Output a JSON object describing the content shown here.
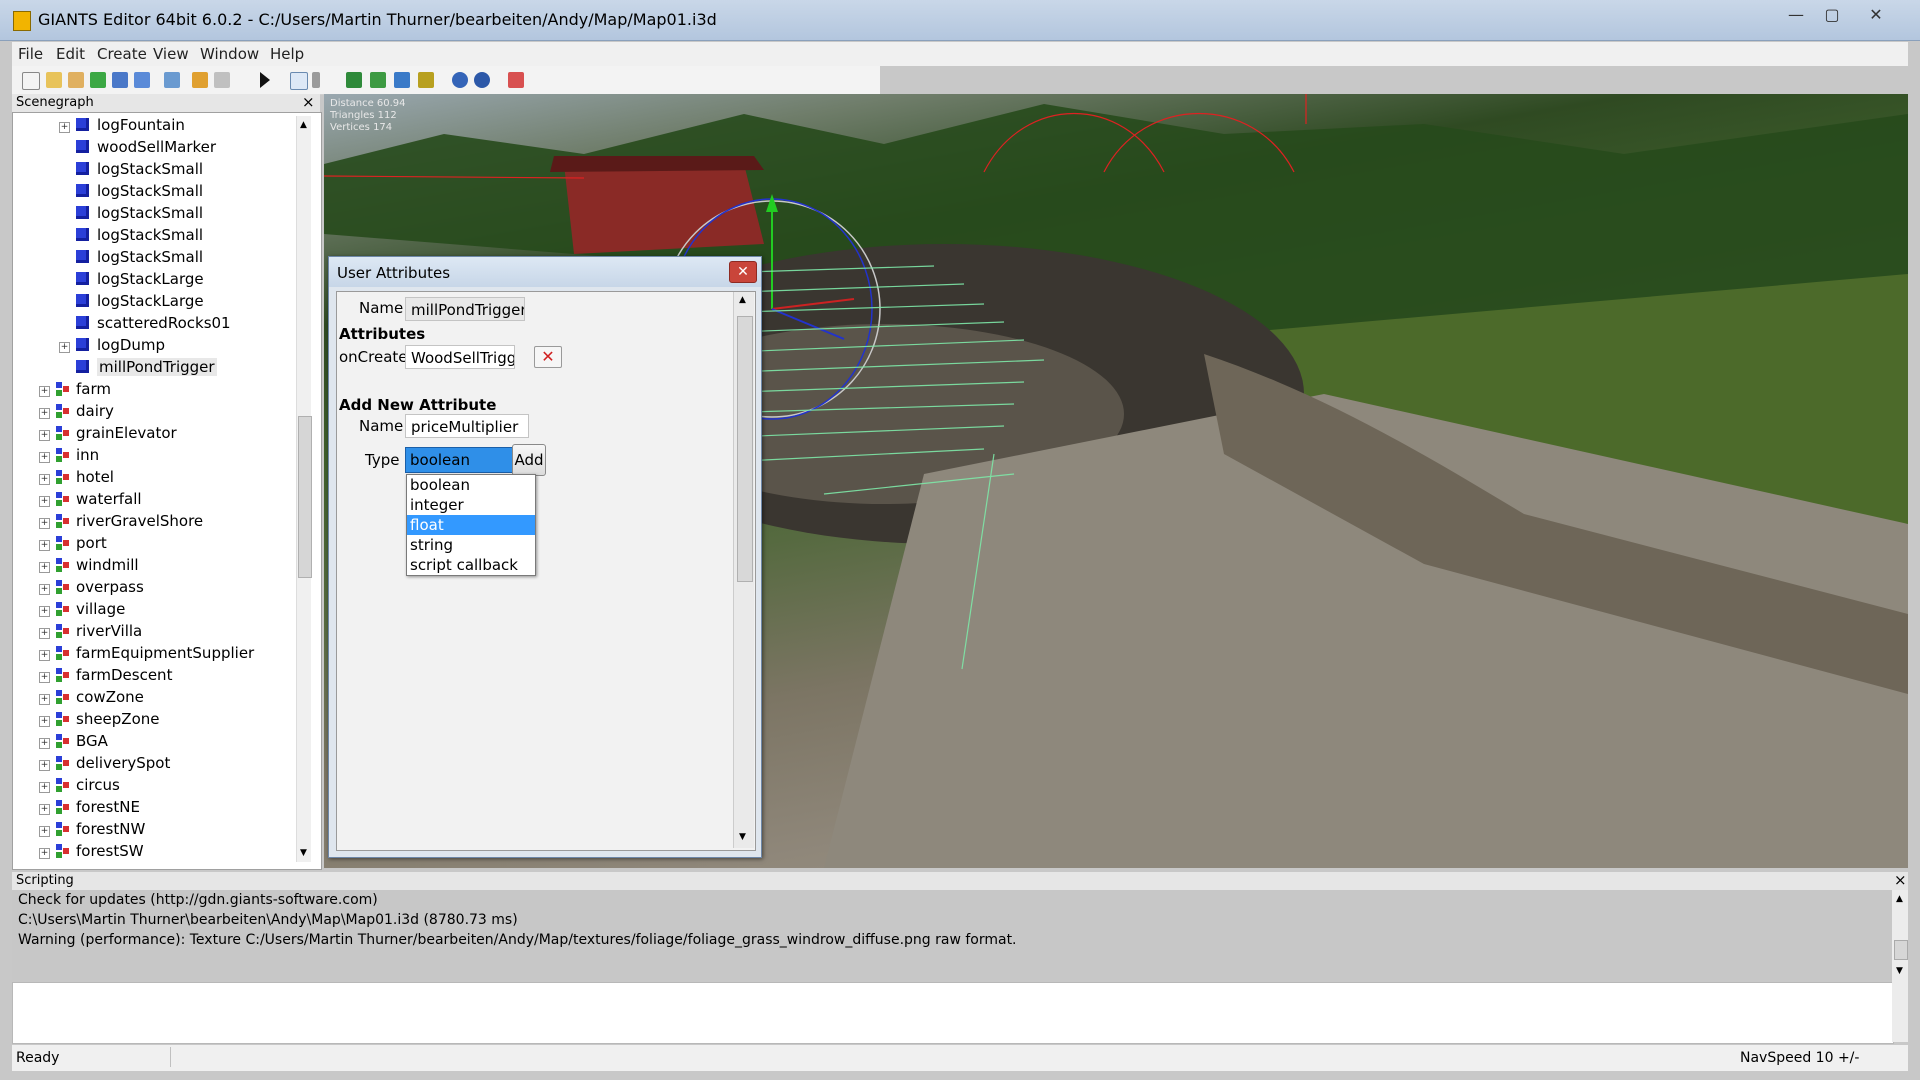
{
  "window": {
    "title": "GIANTS Editor 64bit 6.0.2 - C:/Users/Martin Thurner/bearbeiten/Andy/Map/Map01.i3d",
    "minimize": "—",
    "maximize": "▢",
    "close": "✕"
  },
  "menu": [
    "File",
    "Edit",
    "Create",
    "View",
    "Window",
    "Help"
  ],
  "scenegraph": {
    "title": "Scenegraph",
    "close": "×",
    "children": [
      {
        "label": "logFountain",
        "kind": "cube",
        "expandable": true
      },
      {
        "label": "woodSellMarker",
        "kind": "cube",
        "expandable": false
      },
      {
        "label": "logStackSmall",
        "kind": "cube",
        "expandable": false
      },
      {
        "label": "logStackSmall",
        "kind": "cube",
        "expandable": false
      },
      {
        "label": "logStackSmall",
        "kind": "cube",
        "expandable": false
      },
      {
        "label": "logStackSmall",
        "kind": "cube",
        "expandable": false
      },
      {
        "label": "logStackSmall",
        "kind": "cube",
        "expandable": false
      },
      {
        "label": "logStackLarge",
        "kind": "cube",
        "expandable": false
      },
      {
        "label": "logStackLarge",
        "kind": "cube",
        "expandable": false
      },
      {
        "label": "scatteredRocks01",
        "kind": "cube",
        "expandable": false
      },
      {
        "label": "logDump",
        "kind": "cube",
        "expandable": true
      },
      {
        "label": "millPondTrigger",
        "kind": "cube",
        "expandable": false,
        "selected": true
      }
    ],
    "groups": [
      "farm",
      "dairy",
      "grainElevator",
      "inn",
      "hotel",
      "waterfall",
      "riverGravelShore",
      "port",
      "windmill",
      "overpass",
      "village",
      "riverVilla",
      "farmEquipmentSupplier",
      "farmDescent",
      "cowZone",
      "sheepZone",
      "BGA",
      "deliverySpot",
      "circus",
      "forestNE",
      "forestNW",
      "forestSW"
    ]
  },
  "viewport": {
    "stats": [
      "Distance 60.94",
      "Triangles 112",
      "Vertices 174"
    ]
  },
  "user_attributes": {
    "title": "User Attributes",
    "close": "✕",
    "name_label": "Name",
    "name_value": "millPondTrigger",
    "attributes_heading": "Attributes",
    "oncreate_label": "onCreate",
    "oncreate_value": "WoodSellTrigg",
    "delete_icon": "✕",
    "add_new_heading": "Add New Attribute",
    "new_name_label": "Name",
    "new_name_value": "priceMultiplier",
    "type_label": "Type",
    "type_value": "boolean",
    "add_button": "Add",
    "type_options": [
      "boolean",
      "integer",
      "float",
      "string",
      "script callback"
    ],
    "highlighted_option": "float"
  },
  "scripting": {
    "title": "Scripting",
    "close": "×",
    "lines": [
      "Check for updates (http://gdn.giants-software.com)",
      "C:\\Users\\Martin Thurner\\bearbeiten\\Andy\\Map\\Map01.i3d (8780.73 ms)",
      "Warning (performance): Texture C:/Users/Martin Thurner/bearbeiten/Andy/Map/textures/foliage/foliage_grass_windrow_diffuse.png raw format."
    ]
  },
  "status": {
    "text": "Ready",
    "nav_speed": "NavSpeed 10 +/-"
  }
}
